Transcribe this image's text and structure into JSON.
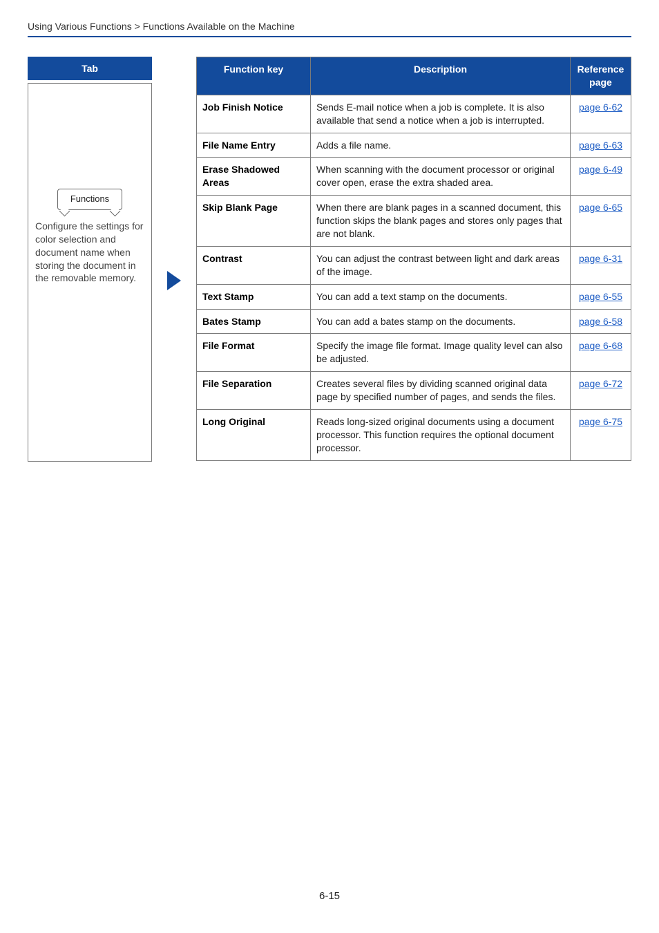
{
  "breadcrumb": "Using Various Functions > Functions Available on the Machine",
  "tab": {
    "header": "Tab",
    "button": "Functions",
    "desc": "Configure the settings for color selection and document name when storing the document in the removable memory."
  },
  "table": {
    "headers": {
      "func": "Function key",
      "desc": "Description",
      "ref": "Reference page"
    },
    "rows": [
      {
        "func": "Job Finish Notice",
        "desc": "Sends E-mail notice when a job is complete. It is also available that send a notice when a job is interrupted.",
        "ref": "page 6-62"
      },
      {
        "func": "File Name Entry",
        "desc": "Adds a file name.",
        "ref": "page 6-63"
      },
      {
        "func": "Erase Shadowed Areas",
        "desc": "When scanning with the document processor or original cover open, erase the extra shaded area.",
        "ref": "page 6-49"
      },
      {
        "func": "Skip Blank Page",
        "desc": "When there are blank pages in a scanned document, this function skips the blank pages and stores only pages that are not blank.",
        "ref": "page 6-65"
      },
      {
        "func": "Contrast",
        "desc": "You can adjust the contrast between light and dark areas of the image.",
        "ref": "page 6-31"
      },
      {
        "func": "Text Stamp",
        "desc": "You can add a text stamp on the documents.",
        "ref": "page 6-55"
      },
      {
        "func": "Bates Stamp",
        "desc": "You can add a bates stamp on the documents.",
        "ref": "page 6-58"
      },
      {
        "func": "File Format",
        "desc": "Specify the image file format. Image quality level can also be adjusted.",
        "ref": "page 6-68"
      },
      {
        "func": "File Separation",
        "desc": "Creates several files by dividing scanned original data page by specified number of pages, and sends the files.",
        "ref": "page 6-72"
      },
      {
        "func": "Long Original",
        "desc": "Reads long-sized original documents using a document processor. This function requires the optional document processor.",
        "ref": "page 6-75"
      }
    ]
  },
  "page_number": "6-15"
}
